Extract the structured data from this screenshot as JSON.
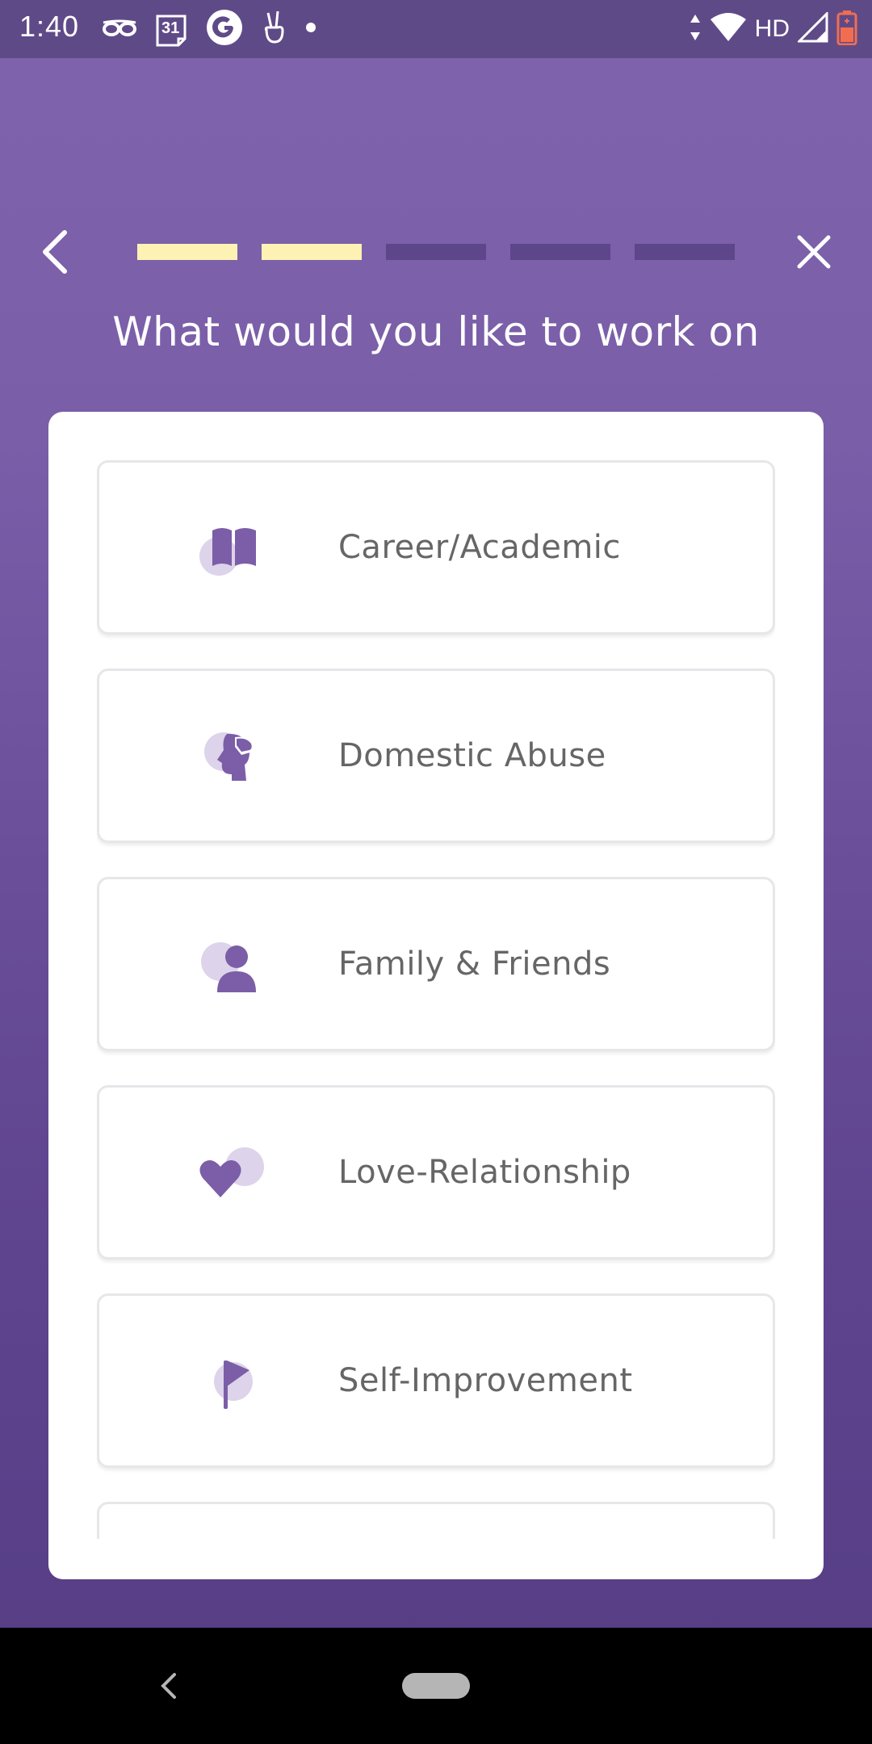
{
  "status_bar": {
    "time": "1:40",
    "calendar_day": "31",
    "network": "HD",
    "icons": [
      "glasses-icon",
      "calendar-icon",
      "google-icon",
      "peace-hand-icon",
      "dot-icon",
      "data-arrows-icon",
      "wifi-icon",
      "signal-icon",
      "battery-icon"
    ]
  },
  "header": {
    "title": "What would you like to work on",
    "progress": {
      "total_steps": 5,
      "completed_steps": 2
    },
    "colors": {
      "done": "#fdf2b4",
      "pending": "#5d4689"
    }
  },
  "topics": [
    {
      "label": "Career/Academic",
      "icon": "book-icon"
    },
    {
      "label": "Domestic Abuse",
      "icon": "head-hand-icon"
    },
    {
      "label": "Family & Friends",
      "icon": "person-icon"
    },
    {
      "label": "Love-Relationship",
      "icon": "heart-icon"
    },
    {
      "label": "Self-Improvement",
      "icon": "flag-icon"
    }
  ],
  "colors": {
    "accent": "#7b5ea7",
    "accent_light": "#ddd3ea",
    "label": "#666666",
    "background_top": "#7f63ac",
    "background_bottom": "#553d83"
  }
}
